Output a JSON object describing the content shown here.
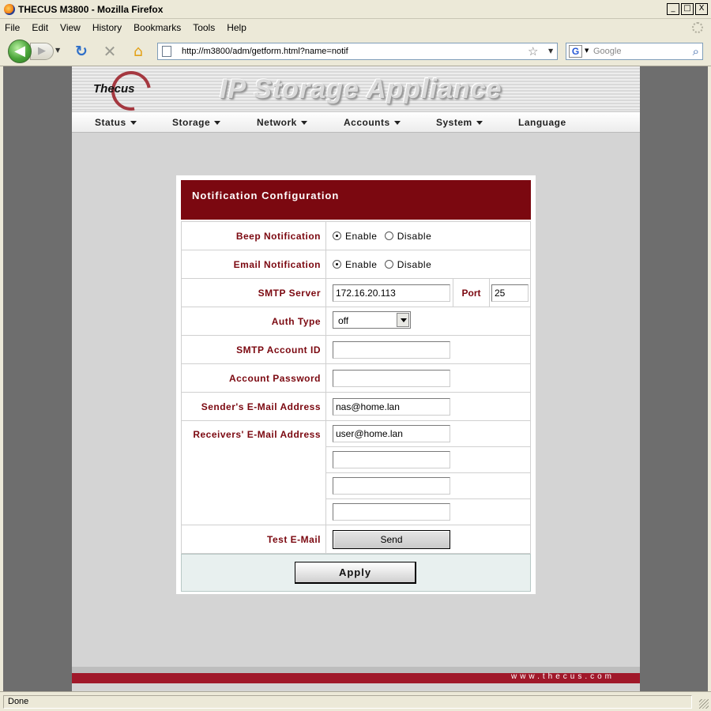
{
  "window": {
    "title": "THECUS M3800 - Mozilla Firefox",
    "minimize": "_",
    "maximize": "□",
    "close": "X"
  },
  "menu": {
    "items": [
      "File",
      "Edit",
      "View",
      "History",
      "Bookmarks",
      "Tools",
      "Help"
    ]
  },
  "toolbar": {
    "url": "http://m3800/adm/getform.html?name=notif",
    "search_placeholder": "Google"
  },
  "site": {
    "logo": "Thecus",
    "title": "IP Storage Appliance",
    "nav": [
      "Status",
      "Storage",
      "Network",
      "Accounts",
      "System",
      "Language"
    ],
    "footer_url": "www.thecus.com"
  },
  "form": {
    "header": "Notification Configuration",
    "beep_label": "Beep Notification",
    "email_label": "Email Notification",
    "enable": "Enable",
    "disable": "Disable",
    "beep_value": "Enable",
    "email_value": "Enable",
    "smtp_server_label": "SMTP Server",
    "smtp_server_value": "172.16.20.113",
    "port_label": "Port",
    "port_value": "25",
    "auth_type_label": "Auth Type",
    "auth_type_value": "off",
    "smtp_account_label": "SMTP Account ID",
    "smtp_account_value": "",
    "password_label": "Account Password",
    "password_value": "",
    "sender_label": "Sender's E-Mail Address",
    "sender_value": "nas@home.lan",
    "receivers_label": "Receivers' E-Mail Address",
    "receivers": [
      "user@home.lan",
      "",
      "",
      ""
    ],
    "test_label": "Test E-Mail",
    "send_button": "Send",
    "apply_button": "Apply"
  },
  "status": {
    "text": "Done"
  }
}
